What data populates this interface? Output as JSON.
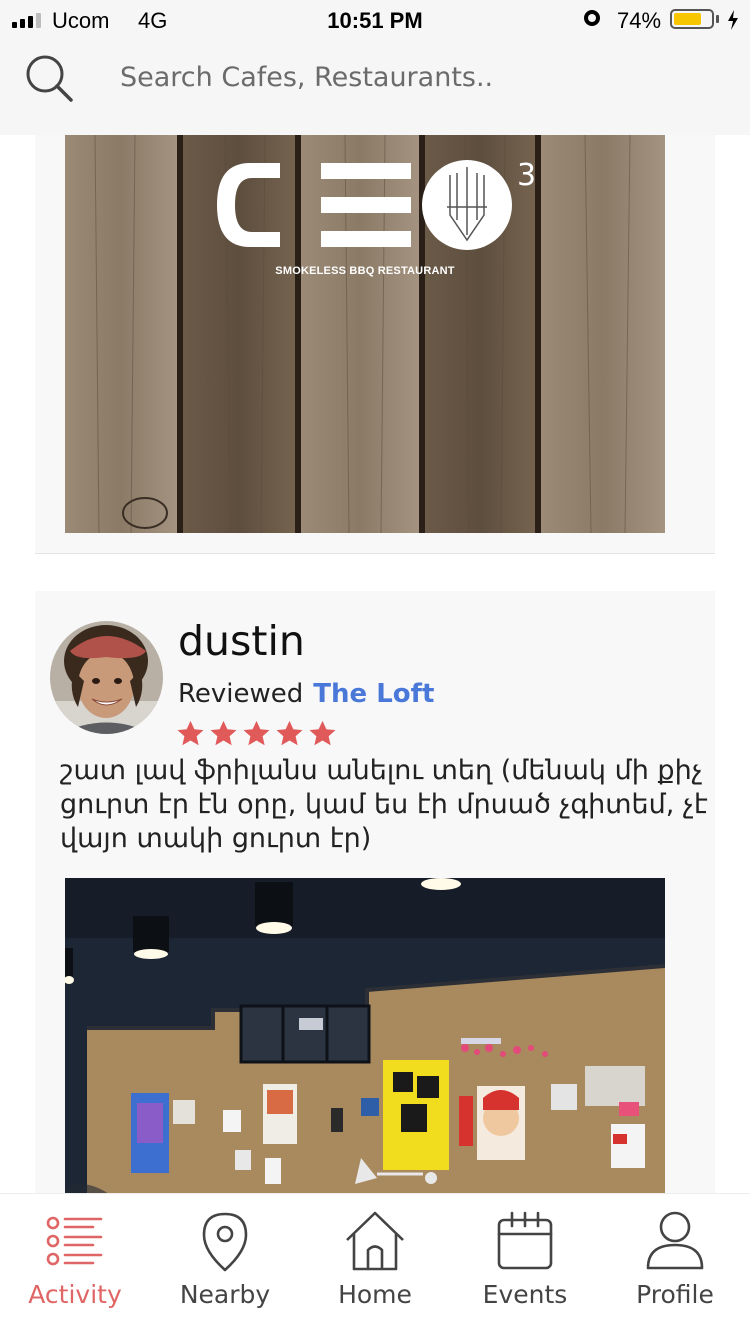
{
  "status_bar": {
    "carrier": "Ucom",
    "network": "4G",
    "time": "10:51 PM",
    "battery_percent": "74%",
    "battery_level": 0.74
  },
  "search": {
    "placeholder": "Search Cafes, Restaurants.."
  },
  "feed": {
    "top_card": {
      "logo_text": "CEO",
      "logo_superscript": "3",
      "logo_tagline": "SMOKELESS BBQ RESTAURANT"
    },
    "review_card": {
      "reviewer_name": "dustin",
      "action_label": "Reviewed",
      "venue_name": "The Loft",
      "rating": 5,
      "rating_max": 5,
      "review_text": "շատ լավ ֆրիլանս անելու տեղ (մենակ մի քիչ ցուրտ էր էն օրը, կամ ես էի մրսած չգիտեմ, չէ վայո տակի ցուրտ էր)"
    }
  },
  "tab_bar": {
    "items": [
      {
        "label": "Activity",
        "icon": "activity-list-icon",
        "active": true
      },
      {
        "label": "Nearby",
        "icon": "map-pin-icon",
        "active": false
      },
      {
        "label": "Home",
        "icon": "home-icon",
        "active": false
      },
      {
        "label": "Events",
        "icon": "calendar-icon",
        "active": false
      },
      {
        "label": "Profile",
        "icon": "user-icon",
        "active": false
      }
    ]
  },
  "colors": {
    "accent": "#e06565",
    "link": "#4a78d8",
    "star": "#e05a5a",
    "battery": "#f7c600"
  }
}
